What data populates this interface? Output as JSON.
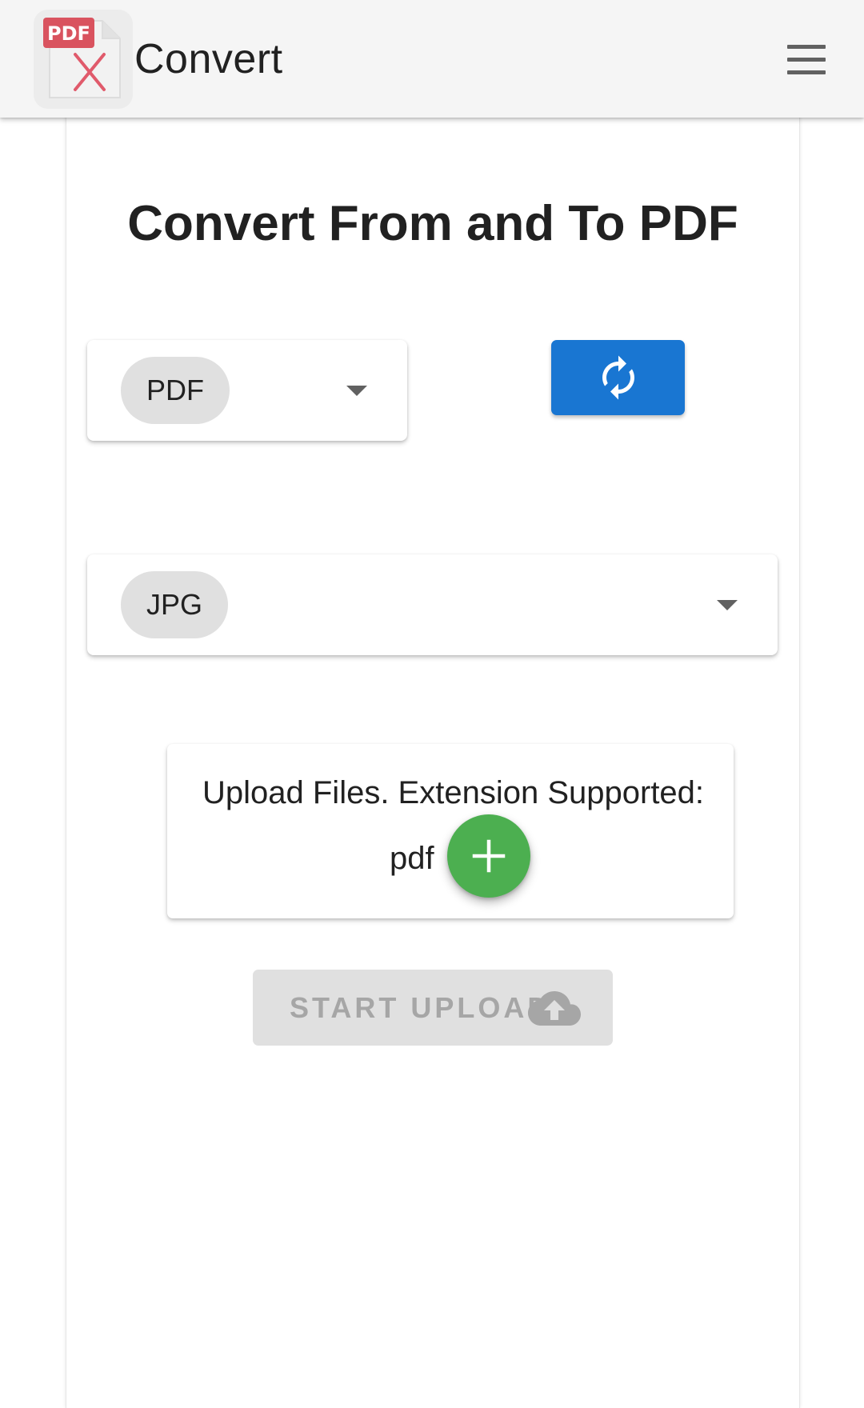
{
  "app": {
    "title": "Convert",
    "logo_badge": "PDF"
  },
  "header": {
    "menu_icon": "hamburger-menu-icon"
  },
  "main": {
    "heading": "Convert From and To PDF",
    "from_select": {
      "value": "PDF"
    },
    "swap_button": {
      "icon": "swap-refresh-icon"
    },
    "to_select": {
      "value": "JPG"
    },
    "upload": {
      "text": "Upload Files. Extension Supported:",
      "extension": "pdf",
      "add_icon": "plus-icon"
    },
    "start_button": {
      "label": "START UPLOAD",
      "icon": "cloud-upload-icon",
      "disabled": true
    }
  },
  "colors": {
    "primary": "#1976d2",
    "fab": "#4caf50",
    "appbar_bg": "#f5f5f5",
    "chip_bg": "#e0e0e0",
    "disabled_bg": "#e0e0e0",
    "disabled_text": "#a6a6a6",
    "logo_red": "#e05a6b"
  }
}
